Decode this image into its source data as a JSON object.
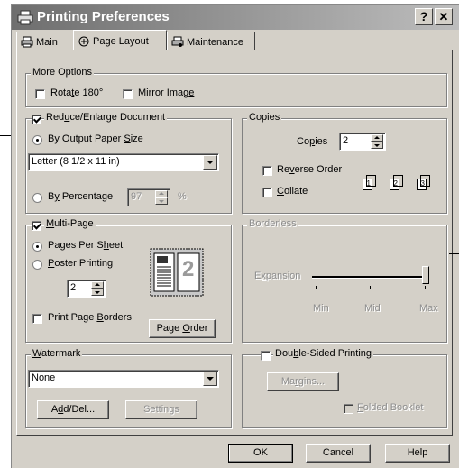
{
  "window": {
    "title": "Printing Preferences",
    "help_btn": "?",
    "close_btn": "✕"
  },
  "tabs": [
    {
      "label": "Main",
      "icon": "printer-icon"
    },
    {
      "label": "Page Layout",
      "icon": "page-layout-icon",
      "active": true
    },
    {
      "label": "Maintenance",
      "icon": "maintenance-icon"
    }
  ],
  "more_options": {
    "legend": "More Options",
    "rotate_pre": "Rota",
    "rotate_u": "t",
    "rotate_post": "e 180°",
    "mirror_pre": "Mirror Imag",
    "mirror_u": "e",
    "mirror_post": ""
  },
  "reduce": {
    "legend_pre": "Red",
    "legend_u": "u",
    "legend_post": "ce/Enlarge Document",
    "output_pre": "By Output Paper ",
    "output_u": "S",
    "output_post": "ize",
    "paper_size": "Letter (8 1/2 x 11 in)",
    "percent_pre": "B",
    "percent_u": "y",
    "percent_post": " Percentage",
    "percent_value": "97",
    "percent_unit": "%"
  },
  "copies": {
    "legend": "Copies",
    "copies_pre": "Co",
    "copies_u": "p",
    "copies_post": "ies",
    "copies_value": "2",
    "reverse_pre": "Re",
    "reverse_u": "v",
    "reverse_post": "erse Order",
    "collate_pre": "",
    "collate_u": "C",
    "collate_post": "ollate",
    "page_nums": [
      "1",
      "2",
      "3"
    ]
  },
  "multipage": {
    "legend_pre": "",
    "legend_u": "M",
    "legend_post": "ulti-Page",
    "pages_pre": "Pages Per S",
    "pages_u": "h",
    "pages_post": "eet",
    "poster_pre": "",
    "poster_u": "P",
    "poster_post": "oster Printing",
    "pages_value": "2",
    "borders_pre": "Print Page ",
    "borders_u": "B",
    "borders_post": "orders",
    "order_pre": "Page ",
    "order_u": "O",
    "order_post": "rder",
    "preview_number": "2"
  },
  "borderless": {
    "legend": "Borderless",
    "expansion_pre": "E",
    "expansion_u": "x",
    "expansion_post": "pansion",
    "min": "Min",
    "mid": "Mid",
    "max": "Max"
  },
  "watermark": {
    "legend_pre": "",
    "legend_u": "W",
    "legend_post": "atermark",
    "value": "None",
    "adddel_pre": "A",
    "adddel_u": "d",
    "adddel_post": "d/Del...",
    "settings": "Settings"
  },
  "duplex": {
    "legend_pre": "Dou",
    "legend_u": "b",
    "legend_post": "le-Sided Printing",
    "margins_pre": "Ma",
    "margins_u": "r",
    "margins_post": "gins...",
    "folded_pre": "",
    "folded_u": "F",
    "folded_post": "olded Booklet"
  },
  "footer": {
    "ok": "OK",
    "cancel": "Cancel",
    "help": "Help"
  },
  "colors": {
    "titlebar_start": "#6e6e6e",
    "titlebar_end": "#bdbdbd",
    "face": "#d4d0c8"
  }
}
